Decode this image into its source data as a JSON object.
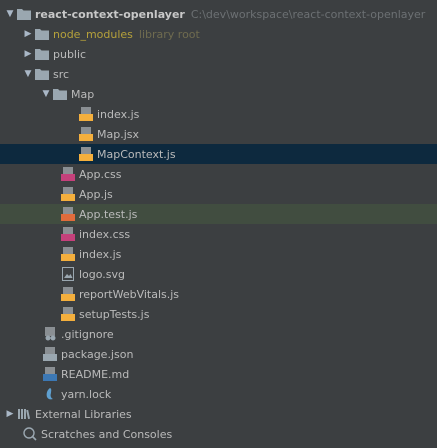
{
  "tree": {
    "root": {
      "name": "react-context-openlayer",
      "path": "C:\\dev\\workspace\\react-context-openlayer"
    },
    "node_modules": {
      "name": "node_modules",
      "hint": "library root"
    },
    "public": "public",
    "src": "src",
    "map_folder": "Map",
    "map_files": [
      "index.js",
      "Map.jsx",
      "MapContext.js"
    ],
    "src_files": [
      "App.css",
      "App.js",
      "App.test.js",
      "index.css",
      "index.js",
      "logo.svg",
      "reportWebVitals.js",
      "setupTests.js"
    ],
    "root_files": [
      ".gitignore",
      "package.json",
      "README.md",
      "yarn.lock"
    ],
    "external_libraries": "External Libraries",
    "scratches": "Scratches and Consoles"
  },
  "colors": {
    "background": "#3c3f41",
    "selected_row": "#0d293e",
    "folder": "#9aa7b0",
    "js_badge": "#f4af3d",
    "css_badge": "#c5417b",
    "excluded_text": "#b5a13b"
  }
}
